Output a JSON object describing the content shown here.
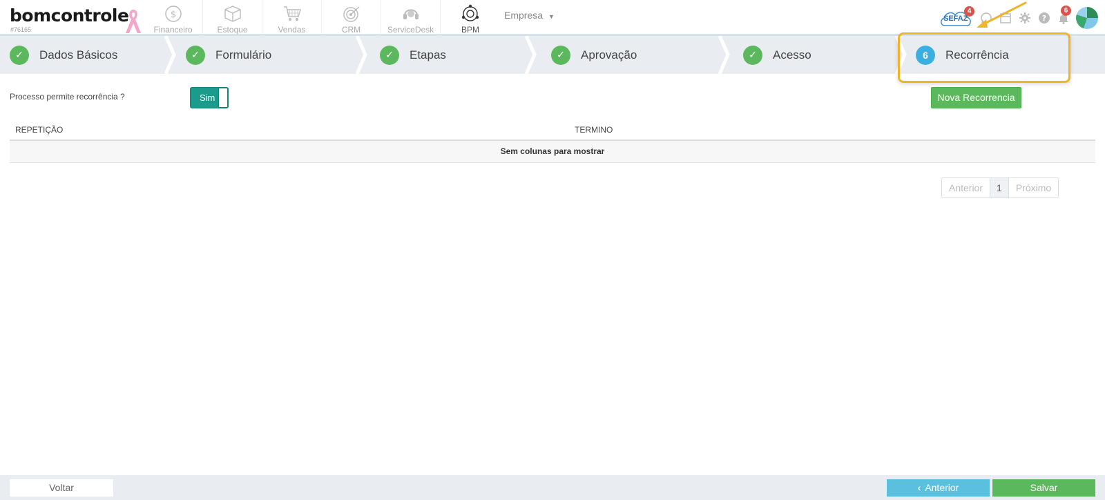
{
  "header": {
    "logo_text": "bomcontrole",
    "account_id": "#76165",
    "modules": [
      {
        "label": "Financeiro",
        "icon": "dollar-circle-icon"
      },
      {
        "label": "Estoque",
        "icon": "box-icon"
      },
      {
        "label": "Vendas",
        "icon": "cart-icon"
      },
      {
        "label": "CRM",
        "icon": "target-icon"
      },
      {
        "label": "ServiceDesk",
        "icon": "headset-icon"
      },
      {
        "label": "BPM",
        "icon": "bpm-network-icon"
      }
    ],
    "active_module": "BPM",
    "company_label": "Empresa",
    "sefaz_label": "SEFAZ",
    "sefaz_badge": "4",
    "notifications_badge": "6"
  },
  "wizard": {
    "steps": [
      {
        "label": "Dados Básicos",
        "status": "done"
      },
      {
        "label": "Formulário",
        "status": "done"
      },
      {
        "label": "Etapas",
        "status": "done"
      },
      {
        "label": "Aprovação",
        "status": "done"
      },
      {
        "label": "Acesso",
        "status": "done"
      },
      {
        "label": "Recorrência",
        "status": "current",
        "number": "6"
      }
    ]
  },
  "recurrence": {
    "question_label": "Processo permite recorrência ?",
    "toggle_value": "Sim",
    "new_button": "Nova Recorrencia"
  },
  "table": {
    "columns": [
      "REPETIÇÃO",
      "TERMINO"
    ],
    "empty_message": "Sem colunas para mostrar"
  },
  "pagination": {
    "prev": "Anterior",
    "page": "1",
    "next": "Próximo"
  },
  "footer": {
    "back_label": "Voltar",
    "previous_label": "Anterior",
    "save_label": "Salvar"
  },
  "colors": {
    "success": "#5cb85c",
    "info": "#5bc0de",
    "toggle": "#1b9b8c",
    "highlight": "#f0b429",
    "badge": "#d9534f"
  }
}
